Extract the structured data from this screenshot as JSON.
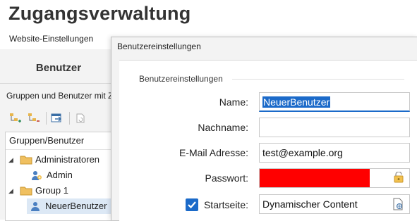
{
  "app": {
    "title": "Zugangsverwaltung",
    "site_settings_label": "Website-Einstellungen"
  },
  "left": {
    "tab_label": "Benutzer",
    "description": "Gruppen und Benutzer mit Z",
    "toolbar": {
      "icons": [
        "add-group-icon",
        "remove-group-icon",
        "export-icon",
        "refresh-icon"
      ]
    },
    "tree": {
      "header": "Gruppen/Benutzer",
      "items": [
        {
          "label": "Administratoren",
          "type": "group",
          "expanded": true
        },
        {
          "label": "Admin",
          "type": "admin-user"
        },
        {
          "label": "Group 1",
          "type": "group",
          "expanded": true
        },
        {
          "label": "NeuerBenutzer",
          "type": "user",
          "selected": true
        }
      ]
    }
  },
  "dialog": {
    "title": "Benutzereinstellungen",
    "section_title": "Benutzereinstellungen",
    "fields": {
      "name": {
        "label": "Name:",
        "value": "NeuerBenutzer"
      },
      "lastname": {
        "label": "Nachname:",
        "value": ""
      },
      "email": {
        "label": "E-Mail Adresse:",
        "value": "test@example.org"
      },
      "password": {
        "label": "Passwort:",
        "value": ""
      },
      "startpage": {
        "label": "Startseite:",
        "value": "Dynamischer Content",
        "checked": true
      }
    }
  },
  "colors": {
    "accent": "#1b6ac9",
    "password_mask": "#ff0000",
    "folder": "#e8b54a"
  }
}
